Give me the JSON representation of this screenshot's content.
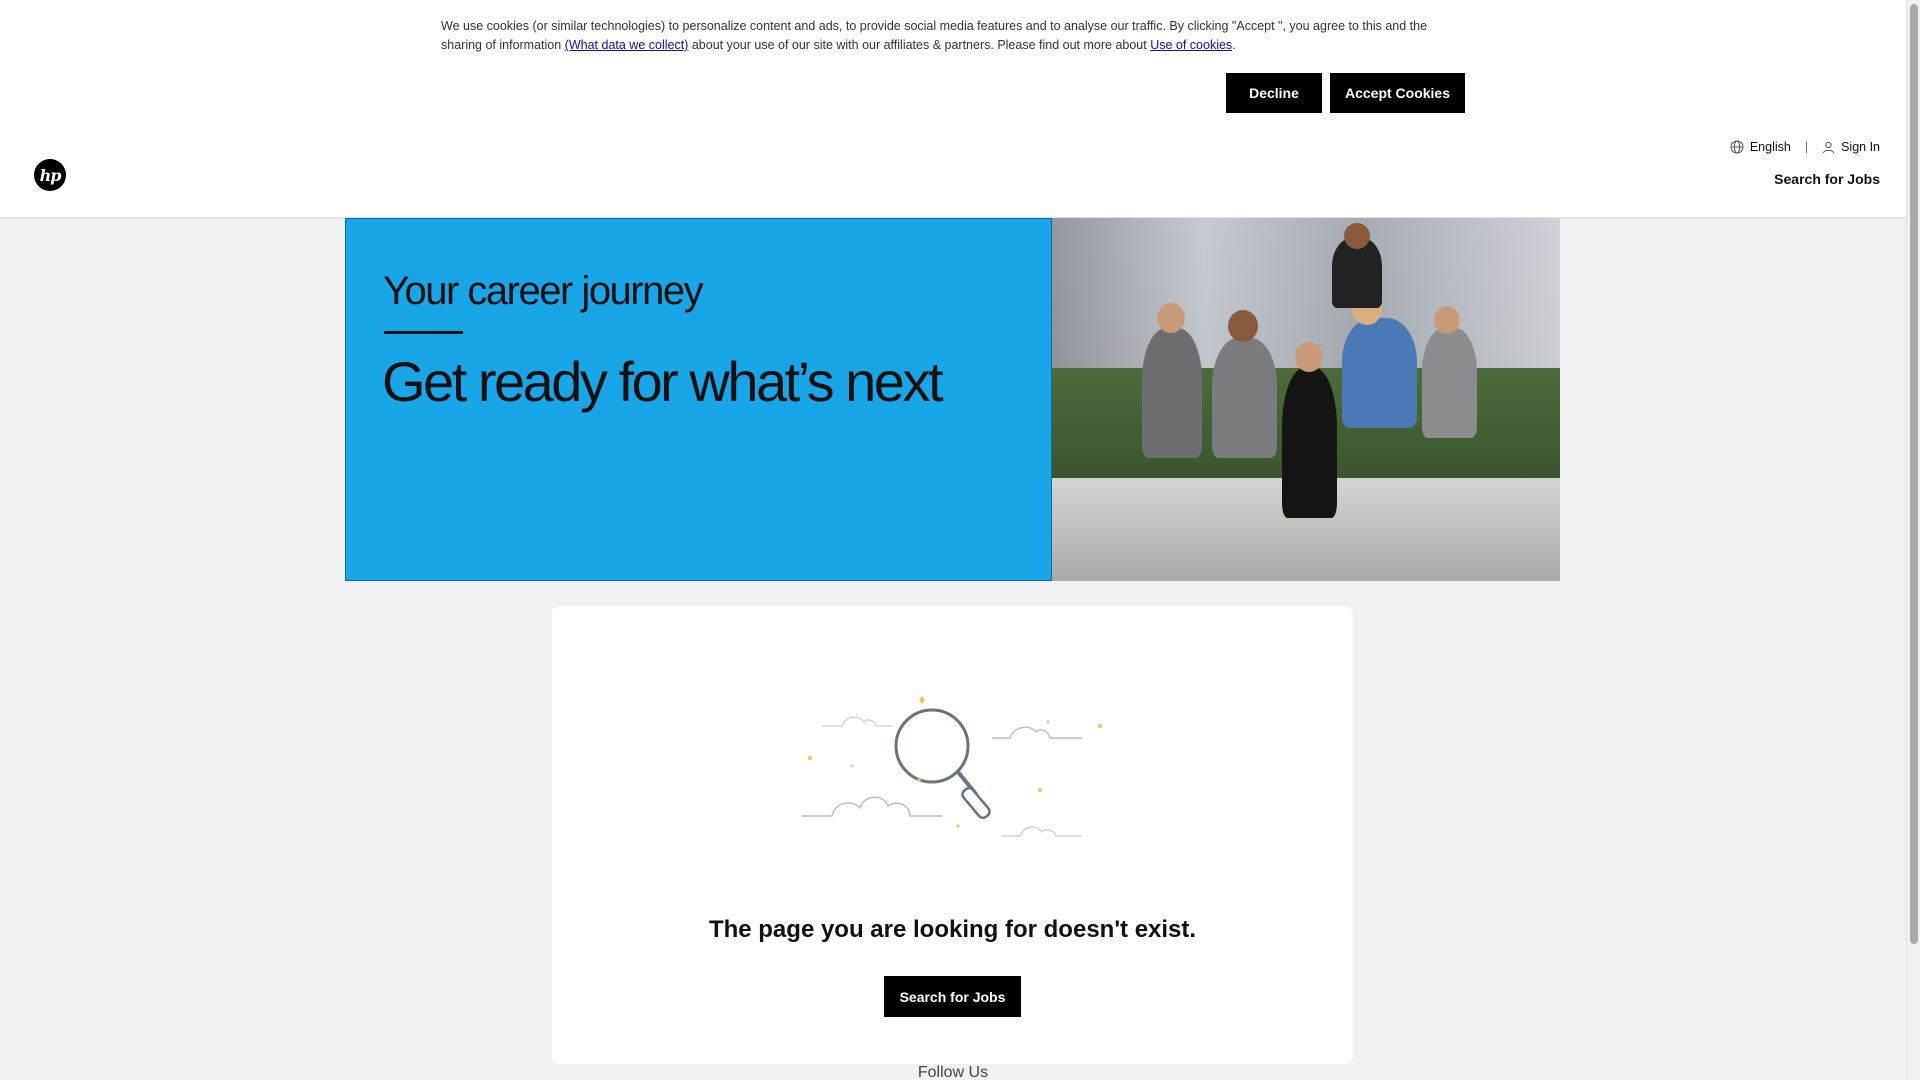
{
  "cookie_banner": {
    "text_part1": "We use cookies (or similar technologies) to personalize content and ads, to provide social media features and to analyse our traffic. By clicking \"Accept \", you agree to this and the sharing of information ",
    "link_data": "(What data we collect)",
    "text_part2": " about your use of our site with our affiliates & partners. Please find out more about ",
    "link_cookies": "Use of cookies",
    "text_part3": ".",
    "decline_label": "Decline",
    "accept_label": "Accept Cookies"
  },
  "header": {
    "logo_text": "hp",
    "language": "English",
    "separator": "|",
    "sign_in": "Sign In",
    "search_jobs": "Search for Jobs"
  },
  "hero": {
    "subtitle": "Your career journey",
    "title": "Get ready for what’s next",
    "bg_color": "#18a6e8"
  },
  "error": {
    "message": "The page you are looking for doesn't exist.",
    "search_button": "Search for Jobs"
  },
  "footer": {
    "follow_us": "Follow Us"
  }
}
